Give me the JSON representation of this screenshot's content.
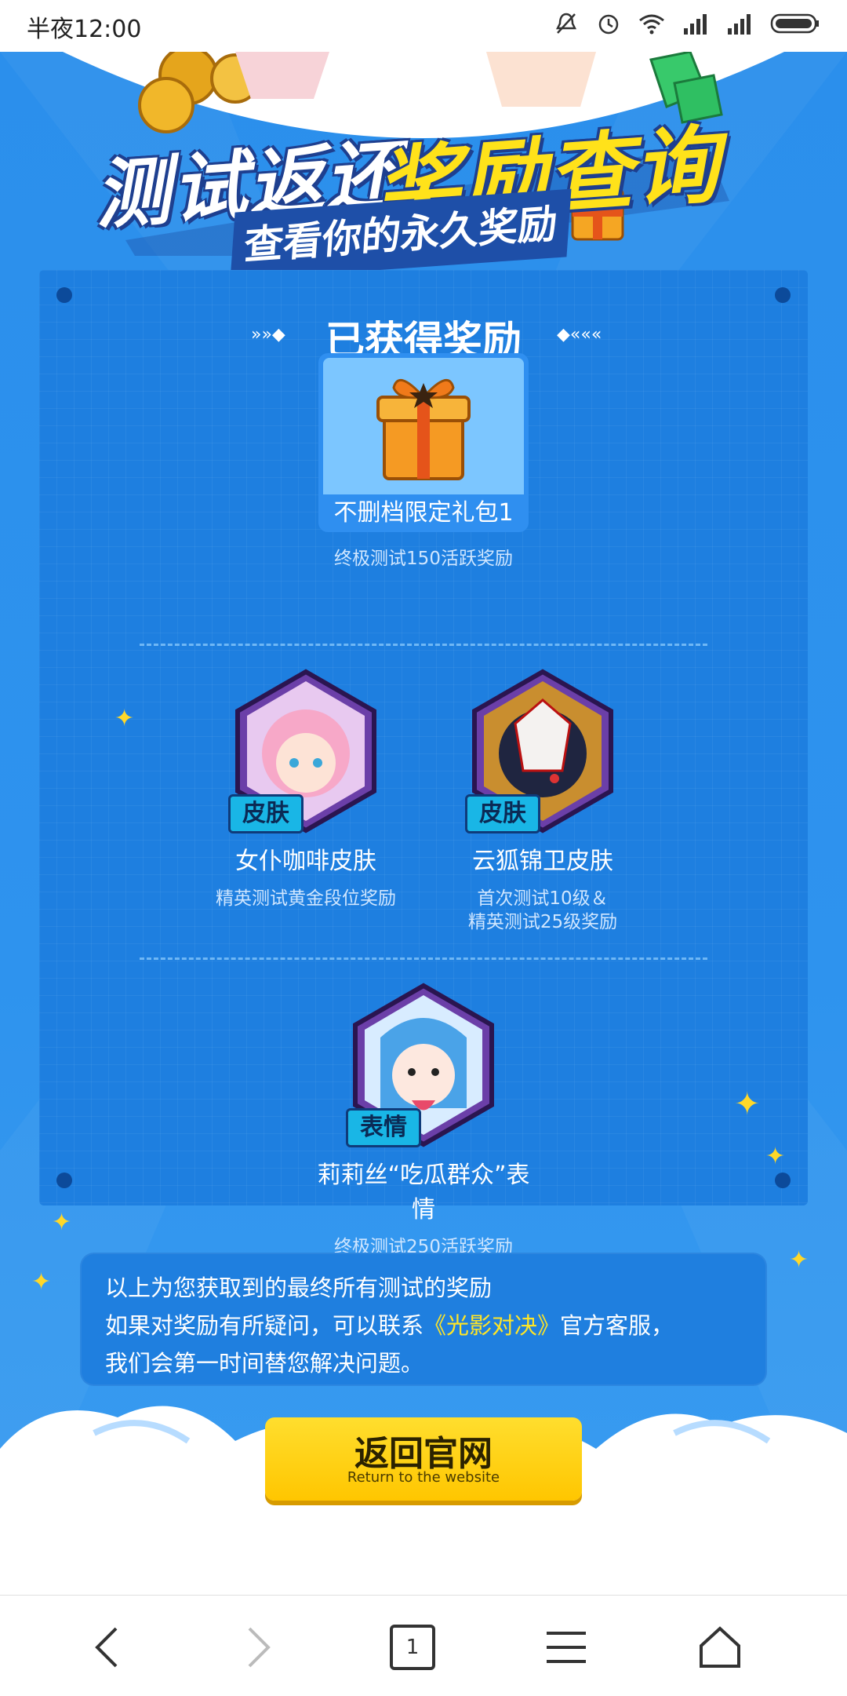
{
  "status_bar": {
    "time": "半夜12:00",
    "icons": [
      "mute-icon",
      "alarm-icon",
      "wifi-icon",
      "signal-icon",
      "signal-icon",
      "battery-icon"
    ]
  },
  "banner": {
    "title_white": "测试返还",
    "title_yellow": "奖励查询",
    "subtitle": "查看你的永久奖励"
  },
  "panel": {
    "heading": "已获得奖励",
    "deco_left": "»»◆",
    "deco_right": "◆«««",
    "gift": {
      "name": "不删档限定礼包1",
      "desc": "终极测试150活跃奖励"
    },
    "rewards": [
      {
        "badge": "皮肤",
        "name": "女仆咖啡皮肤",
        "desc_line1": "精英测试黄金段位奖励",
        "desc_line2": ""
      },
      {
        "badge": "皮肤",
        "name": "云狐锦卫皮肤",
        "desc_line1": "首次测试10级＆",
        "desc_line2": "精英测试25级奖励"
      },
      {
        "badge": "表情",
        "name": "莉莉丝“吃瓜群众”表情",
        "desc_line1": "终极测试250活跃奖励",
        "desc_line2": ""
      }
    ]
  },
  "notice": {
    "line1": "以上为您获取到的最终所有测试的奖励",
    "line2_pre": "如果对奖励有所疑问，可以联系",
    "line2_highlight": "《光影对决》",
    "line2_post": "官方客服，",
    "line3": "我们会第一时间替您解决问题。"
  },
  "return_button": {
    "label": "返回官网",
    "sublabel": "Return to the website"
  },
  "nav": {
    "tab_count": "1"
  },
  "colors": {
    "page_blue": "#2d8ee8",
    "panel_blue": "#1e7fe0",
    "accent_yellow": "#ffd400",
    "highlight_yellow": "#ffe526"
  }
}
